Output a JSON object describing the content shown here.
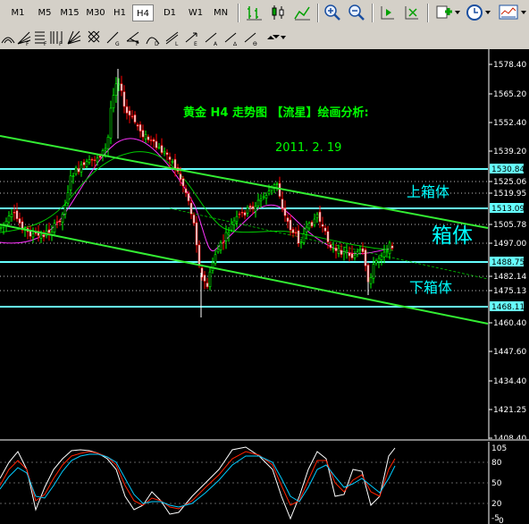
{
  "toolbar": {
    "timeframes": [
      "M1",
      "M5",
      "M15",
      "M30",
      "H1",
      "H4",
      "D1",
      "W1",
      "MN"
    ],
    "active_timeframe": "H4"
  },
  "colors": {
    "background": "#000000",
    "bull": "#00ff00",
    "bear": "#ff0000",
    "candle_fill_up": "#000000",
    "candle_fill_down": "#ffffff",
    "trend_line": "#33ee33",
    "box_line": "#66ffff",
    "annotation_title": "#00ff00",
    "annotation_box": "#00ffff",
    "stoch_main": "#ffffff",
    "stoch_signal": "#ff2200",
    "stoch_extra": "#00ccff"
  },
  "annotations": {
    "title": "黄金  H4  走势图  【流星】绘画分析:",
    "date": "2011. 2. 19",
    "upper_box": "上箱体",
    "box": "箱体",
    "lower_box": "下箱体"
  },
  "price_axis": {
    "ticks": [
      "1578.40",
      "1565.20",
      "1552.40",
      "1539.20",
      "1525.06",
      "1519.95",
      "1505.78",
      "1497.00",
      "1482.14",
      "1475.13",
      "1460.40",
      "1447.60",
      "1434.40",
      "1421.25",
      "1408.40"
    ],
    "tags": [
      "1530.84",
      "1513.09",
      "1488.75",
      "1468.11"
    ]
  },
  "indicator_axis": {
    "ticks": [
      "105",
      "80",
      "50",
      "20",
      "-5",
      "0"
    ]
  }
}
